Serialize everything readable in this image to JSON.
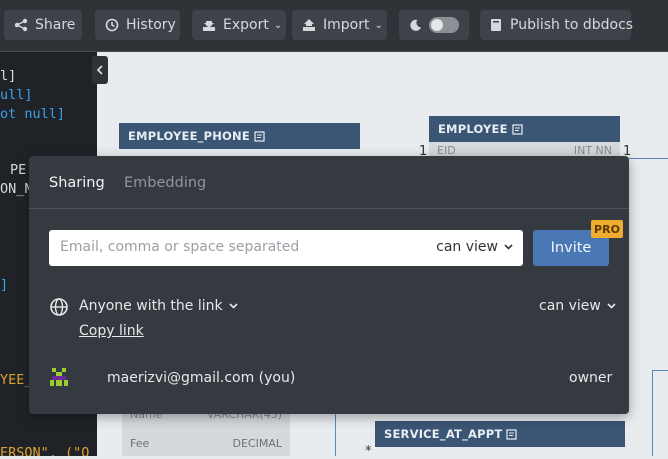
{
  "toolbar": {
    "share_label": "Share",
    "history_label": "History",
    "export_label": "Export",
    "import_label": "Import",
    "publish_label": "Publish to dbdocs"
  },
  "editor": {
    "lines": [
      {
        "text": "l]",
        "color": "#d8d8d8"
      },
      {
        "text": "ull]",
        "color": "#3aa0e6"
      },
      {
        "text": "ot null]",
        "color": "#3aa0e6"
      },
      {
        "text": "PE",
        "color": "#d8d8d8"
      },
      {
        "text": "ON_N",
        "color": "#d8d8d8"
      },
      {
        "text": "]",
        "color": "#3aa0e6"
      },
      {
        "text": "YEE_",
        "color": "#e0a030"
      },
      {
        "text": "ERSON\", (\"O",
        "color": "#e0a030"
      }
    ]
  },
  "diagram": {
    "tables": [
      {
        "name": "EMPLOYEE_PHONE"
      },
      {
        "name": "EMPLOYEE"
      },
      {
        "name": "SERVICE_AT_APPT"
      }
    ],
    "fields": [
      {
        "name": "EID",
        "type": "INT NN"
      },
      {
        "name": "Name",
        "type": "VARCHAR(45)"
      },
      {
        "name": "Fee",
        "type": "DECIMAL"
      }
    ],
    "rel_labels": [
      "1",
      "1",
      "*"
    ]
  },
  "share_modal": {
    "tab_sharing": "Sharing",
    "tab_embedding": "Embedding",
    "email_placeholder": "Email, comma or space separated",
    "invite_permission": "can view",
    "invite_label": "Invite",
    "pro_badge": "PRO",
    "link_access": "Anyone with the link",
    "link_permission": "can view",
    "copy_link": "Copy link",
    "owner_email": "maerizvi@gmail.com (you)",
    "owner_role": "owner"
  }
}
